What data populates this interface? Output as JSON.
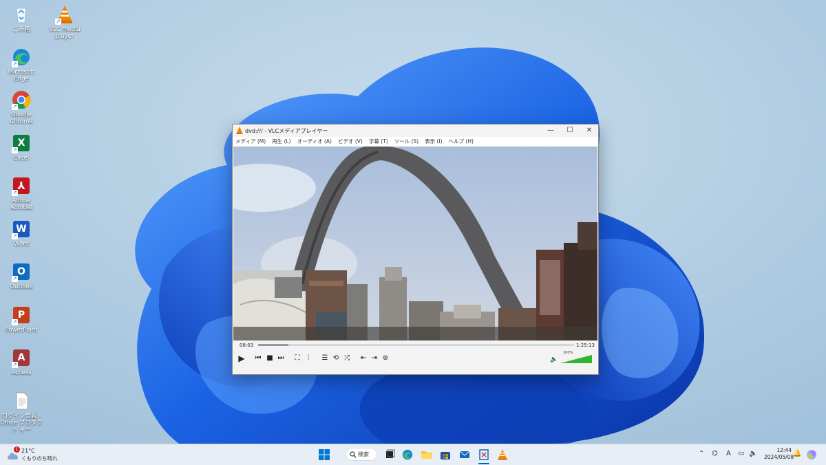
{
  "desktop": {
    "icons": [
      {
        "label": "ごみ箱",
        "icon": "recycle-bin-icon"
      },
      {
        "label": "VLC media player",
        "icon": "vlc-icon"
      },
      {
        "label": "Microsoft Edge",
        "icon": "edge-icon"
      },
      {
        "label": "Google Chrome",
        "icon": "chrome-icon"
      },
      {
        "label": "Excel",
        "icon": "excel-icon"
      },
      {
        "label": "Adobe Acrobat",
        "icon": "acrobat-icon"
      },
      {
        "label": "Word",
        "icon": "word-icon"
      },
      {
        "label": "Outlook",
        "icon": "outlook-icon"
      },
      {
        "label": "PowerPoint",
        "icon": "powerpoint-icon"
      },
      {
        "label": "Access",
        "icon": "access-icon"
      },
      {
        "label": "ログイン情報 - Office プロダクト キー",
        "icon": "document-icon"
      }
    ]
  },
  "vlc": {
    "title": "dvd:/// - VLCメディアプレイヤー",
    "menus": [
      "メディア (M)",
      "再生 (L)",
      "オーディオ (A)",
      "ビデオ (V)",
      "字幕 (T)",
      "ツール (S)",
      "表示 (I)",
      "ヘルプ (H)"
    ],
    "elapsed": "08:03",
    "total": "1:25:13",
    "progress": 0.095,
    "volume_label": "100%",
    "volume": 1.0
  },
  "taskbar": {
    "weather_temp": "21°C",
    "weather_condition": "くもりのち晴れ",
    "weather_badge": "1",
    "search_label": "検索",
    "time": "12:44",
    "date": "2024/05/08",
    "ime_label": "A"
  },
  "colors": {
    "wallpaper": "#a9c7df",
    "bloom_blue": "#1f6fe0",
    "volume_green": "#2fb52f",
    "windows_accent": "#0067c0"
  }
}
